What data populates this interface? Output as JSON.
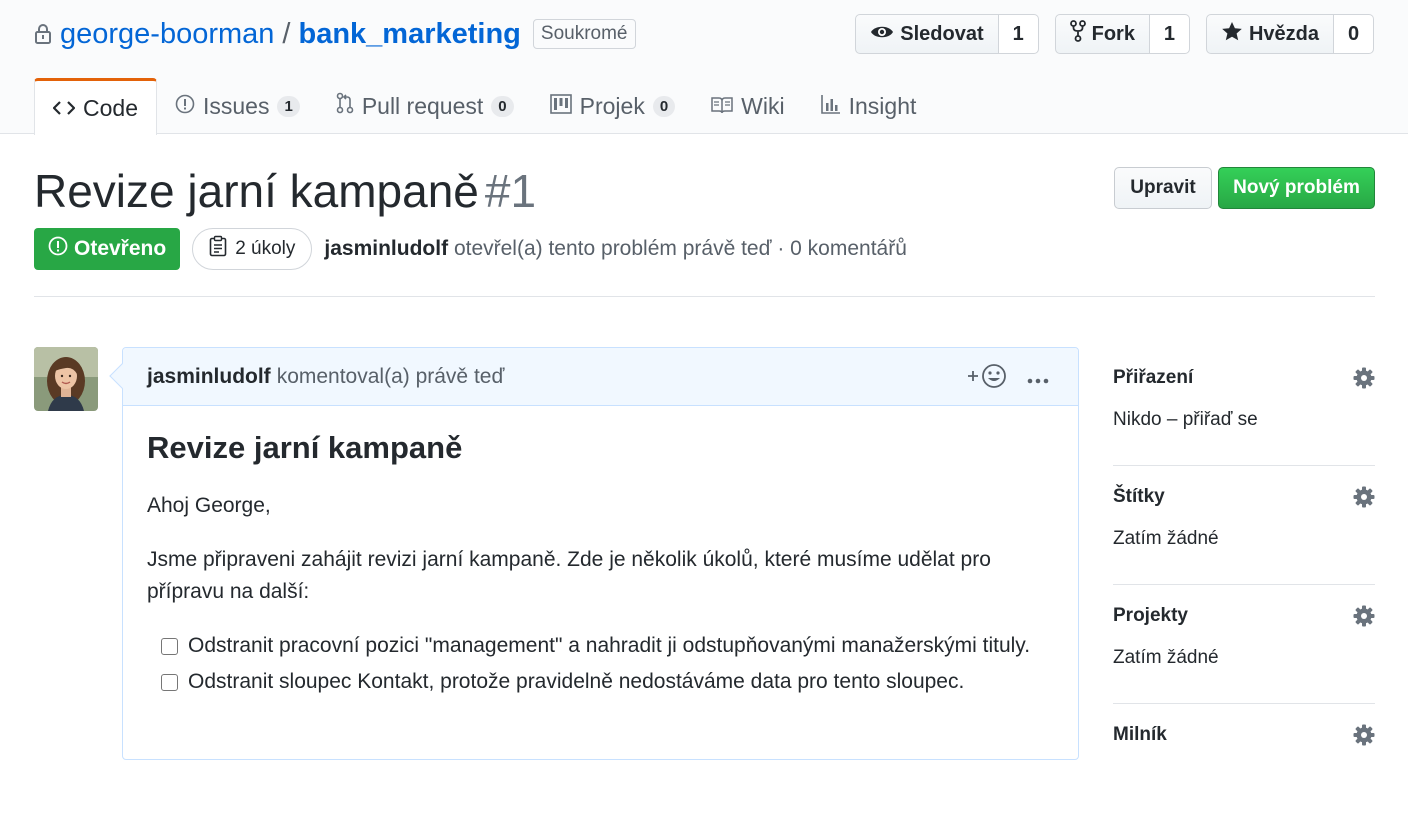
{
  "repo": {
    "owner": "george-boorman",
    "separator": "/",
    "name": "bank_marketing",
    "visibility": "Soukromé"
  },
  "actions": [
    {
      "label": "Sledovat",
      "count": "1",
      "icon": "eye-icon"
    },
    {
      "label": "Fork",
      "count": "1",
      "icon": "fork-icon"
    },
    {
      "label": "Hvězda",
      "count": "0",
      "icon": "star-icon"
    }
  ],
  "tabs": [
    {
      "label": "Code",
      "selected": true,
      "icon": "code-icon"
    },
    {
      "label": "Issues",
      "counter": "1",
      "icon": "issue-icon"
    },
    {
      "label": "Pull request",
      "counter": "0",
      "icon": "pull-request-icon"
    },
    {
      "label": "Projek",
      "counter": "0",
      "icon": "project-icon"
    },
    {
      "label": "Wiki",
      "icon": "book-icon"
    },
    {
      "label": "Insight",
      "icon": "graph-icon"
    }
  ],
  "issue": {
    "title": "Revize jarní kampaně",
    "number": "#1",
    "state": "Otevřeno",
    "tasks": "2 úkoly",
    "author": "jasminludolf",
    "meta": "otevřel(a) tento problém právě teď · 0 komentářů",
    "edit_label": "Upravit",
    "new_label": "Nový problém"
  },
  "comment": {
    "author": "jasminludolf",
    "action": "komentoval(a) právě teď",
    "heading": "Revize jarní kampaně",
    "greeting": "Ahoj George,",
    "paragraph": "Jsme připraveni zahájit revizi jarní kampaně. Zde je několik úkolů, které musíme udělat pro přípravu na další:",
    "tasks": [
      "Odstranit pracovní pozici \"management\" a nahradit ji odstupňovanými manažerskými tituly.",
      "Odstranit sloupec Kontakt, protože pravidelně nedostáváme data pro tento sloupec."
    ]
  },
  "sidebar": [
    {
      "title": "Přiřazení",
      "value": "Nikdo – přiřaď se"
    },
    {
      "title": "Štítky",
      "value": "Zatím žádné"
    },
    {
      "title": "Projekty",
      "value": "Zatím žádné"
    },
    {
      "title": "Milník",
      "value": ""
    }
  ],
  "colors": {
    "accent": "#0366d6",
    "success": "#28a745",
    "tab_highlight": "#e36209",
    "comment_header": "#f1f8ff"
  }
}
